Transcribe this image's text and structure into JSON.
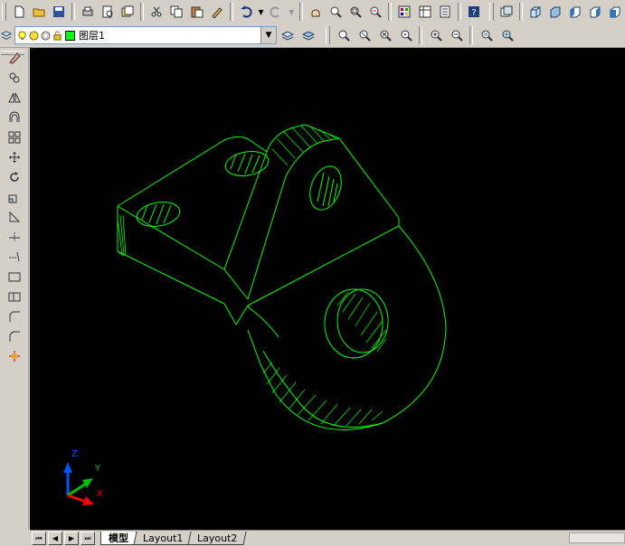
{
  "layer": {
    "current_name": "图层1"
  },
  "tabs": [
    {
      "label": "模型"
    },
    {
      "label": "Layout1"
    },
    {
      "label": "Layout2"
    }
  ],
  "ucs": {
    "x": "X",
    "y": "Y",
    "z": "Z"
  },
  "colors": {
    "canvas_bg": "#000000",
    "model_line": "#00ff00",
    "ucs_z": "#0055ff",
    "ucs_y": "#00c000",
    "ucs_x": "#ff0000"
  },
  "toolbar": {
    "standard_icons": [
      "new-icon",
      "open-icon",
      "save-icon",
      "plot-icon",
      "plot-preview-icon",
      "publish-icon",
      "cut-icon",
      "copy-icon",
      "paste-icon",
      "match-properties-icon",
      "undo-icon",
      "redo-icon",
      "pan-icon",
      "zoom-realtime-icon",
      "zoom-window-icon",
      "zoom-previous-icon",
      "properties-icon",
      "design-center-icon",
      "tool-palettes-icon",
      "help-icon"
    ],
    "view_icons": [
      "named-views-icon",
      "top-view-icon",
      "bottom-view-icon",
      "left-view-icon",
      "right-view-icon",
      "front-view-icon"
    ]
  },
  "modify_tools": [
    "erase-icon",
    "copy-object-icon",
    "mirror-icon",
    "offset-icon",
    "array-icon",
    "move-icon",
    "rotate-icon",
    "scale-icon",
    "stretch-icon",
    "trim-icon",
    "extend-icon",
    "break-icon",
    "join-icon",
    "chamfer-icon",
    "fillet-icon",
    "explode-icon"
  ]
}
